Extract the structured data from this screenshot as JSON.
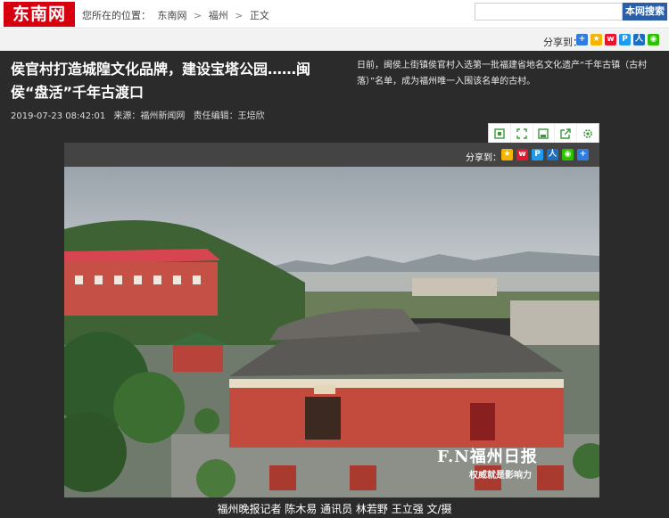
{
  "site": {
    "logo": "东南网"
  },
  "breadcrumb": {
    "prefix": "您所在的位置：",
    "items": [
      "东南网",
      "福州",
      "正文"
    ],
    "sep": ">"
  },
  "search": {
    "placeholder": "",
    "button_label": "本网搜索"
  },
  "share": {
    "label": "分享到：",
    "icons": [
      "qzone-icon",
      "qq-star-icon",
      "weibo-icon",
      "tencent-weibo-icon",
      "renren-icon",
      "wechat-icon"
    ]
  },
  "article": {
    "title": "侯官村打造城隍文化品牌，建设宝塔公园……闽侯“盘活”千年古渡口",
    "date": "2019-07-23 08:42:01",
    "source": "来源：福州新闻网",
    "editor": "责任编辑：王培欣",
    "summary": "日前，闽侯上街镇侯官村入选第一批福建省地名文化遗产“千年古镇（古村落）”名单，成为福州唯一入围该名单的古村。"
  },
  "toolbar": {
    "buttons": [
      "fit-icon",
      "fullscreen-icon",
      "save-icon",
      "open-icon",
      "settings-icon"
    ]
  },
  "photo": {
    "share_label": "分享到：",
    "watermark_brand": "F.N福州日报",
    "watermark_slogan": "权威就是影响力",
    "caption": "福州晚报记者 陈木易 通讯员 林若野 王立强 文/摄"
  },
  "colors": {
    "brand_red": "#d7000f",
    "search_blue": "#2a5fa8",
    "dark_bg": "#2b2b2b"
  }
}
